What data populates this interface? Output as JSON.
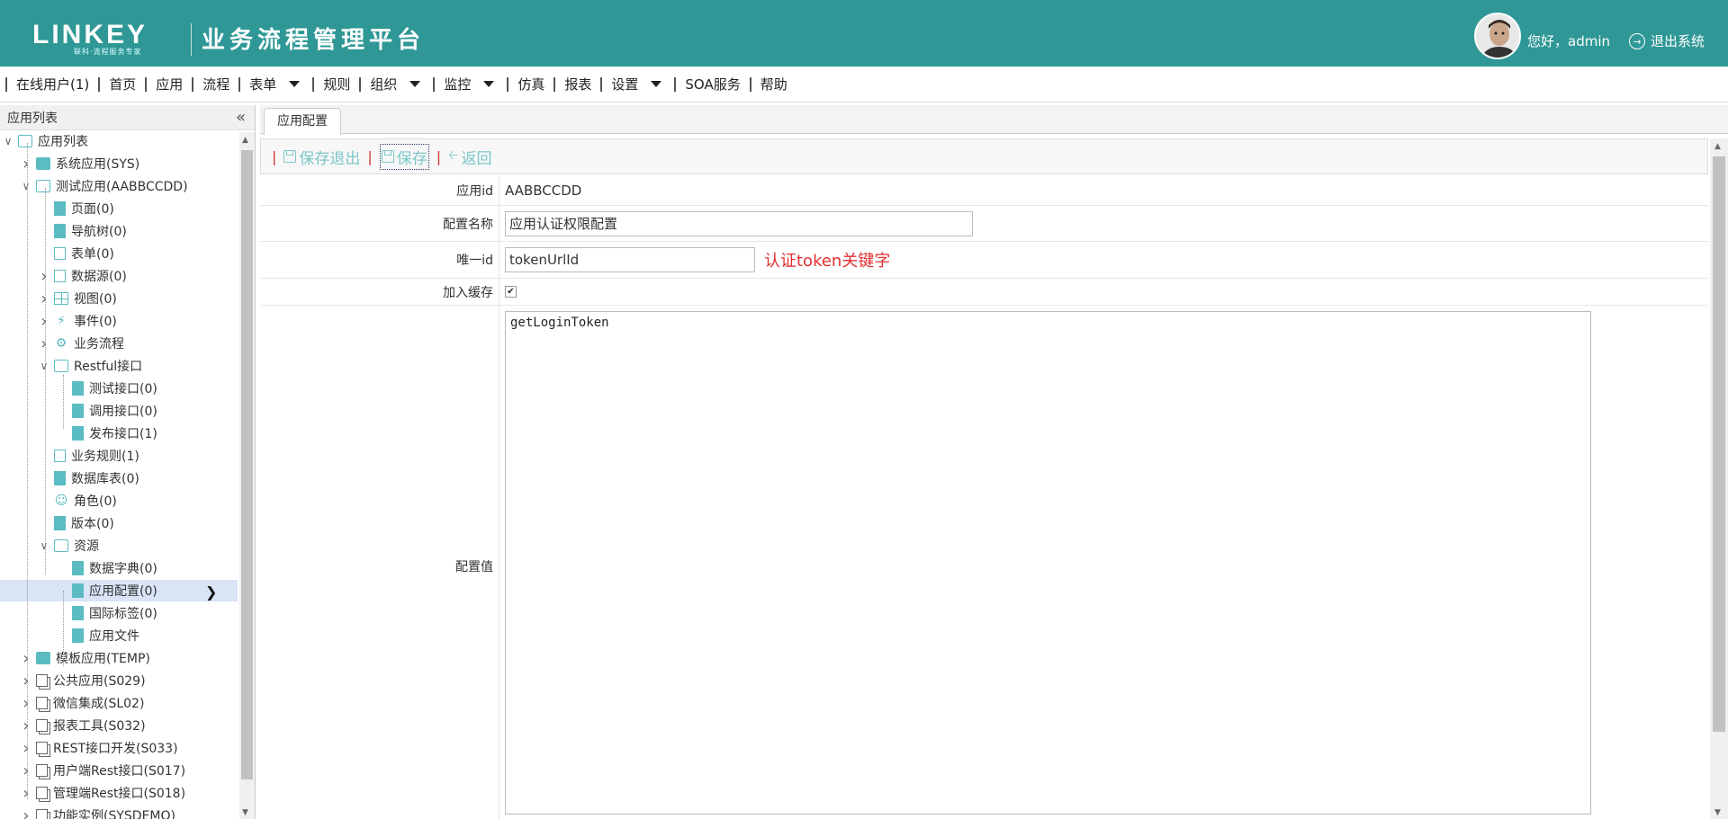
{
  "header": {
    "logo_text": "LINKEY",
    "logo_subtitle": "联科·流程服务专家",
    "app_title": "业务流程管理平台",
    "greeting": "您好，admin",
    "logout_label": "退出系统",
    "background": "#2f9896"
  },
  "menu": {
    "items": [
      {
        "label": "在线用户(1)",
        "has_dropdown": false
      },
      {
        "label": "首页",
        "has_dropdown": false
      },
      {
        "label": "应用",
        "has_dropdown": false
      },
      {
        "label": "流程",
        "has_dropdown": false
      },
      {
        "label": "表单",
        "has_dropdown": true
      },
      {
        "label": "规则",
        "has_dropdown": false
      },
      {
        "label": "组织",
        "has_dropdown": true
      },
      {
        "label": "监控",
        "has_dropdown": true
      },
      {
        "label": "仿真",
        "has_dropdown": false
      },
      {
        "label": "报表",
        "has_dropdown": false
      },
      {
        "label": "设置",
        "has_dropdown": true
      },
      {
        "label": "SOA服务",
        "has_dropdown": false
      },
      {
        "label": "帮助",
        "has_dropdown": false
      }
    ]
  },
  "sidebar": {
    "title": "应用列表",
    "tree": [
      {
        "label": "应用列表",
        "level": 0,
        "toggle": "open",
        "icon": "folder-open-icon"
      },
      {
        "label": "系统应用(SYS)",
        "level": 1,
        "toggle": "closed",
        "icon": "folder-icon"
      },
      {
        "label": "测试应用(AABBCCDD)",
        "level": 1,
        "toggle": "open",
        "icon": "folder-open-icon"
      },
      {
        "label": "页面(0)",
        "level": 2,
        "toggle": "none",
        "icon": "file-icon"
      },
      {
        "label": "导航树(0)",
        "level": 2,
        "toggle": "none",
        "icon": "file-icon"
      },
      {
        "label": "表单(0)",
        "level": 2,
        "toggle": "none",
        "icon": "form-icon"
      },
      {
        "label": "数据源(0)",
        "level": 2,
        "toggle": "closed",
        "icon": "datasource-icon"
      },
      {
        "label": "视图(0)",
        "level": 2,
        "toggle": "closed",
        "icon": "grid-icon"
      },
      {
        "label": "事件(0)",
        "level": 2,
        "toggle": "closed",
        "icon": "bolt-icon"
      },
      {
        "label": "业务流程",
        "level": 2,
        "toggle": "closed",
        "icon": "gears-icon"
      },
      {
        "label": "Restful接口",
        "level": 2,
        "toggle": "open",
        "icon": "folder-open-icon"
      },
      {
        "label": "测试接口(0)",
        "level": 3,
        "toggle": "none",
        "icon": "file-icon"
      },
      {
        "label": "调用接口(0)",
        "level": 3,
        "toggle": "none",
        "icon": "file-icon"
      },
      {
        "label": "发布接口(1)",
        "level": 3,
        "toggle": "none",
        "icon": "file-icon"
      },
      {
        "label": "业务规则(1)",
        "level": 2,
        "toggle": "none",
        "icon": "rules-icon"
      },
      {
        "label": "数据库表(0)",
        "level": 2,
        "toggle": "none",
        "icon": "file-icon"
      },
      {
        "label": "角色(0)",
        "level": 2,
        "toggle": "none",
        "icon": "user-icon"
      },
      {
        "label": "版本(0)",
        "level": 2,
        "toggle": "none",
        "icon": "file-icon"
      },
      {
        "label": "资源",
        "level": 2,
        "toggle": "open",
        "icon": "folder-open-icon"
      },
      {
        "label": "数据字典(0)",
        "level": 3,
        "toggle": "none",
        "icon": "file-icon"
      },
      {
        "label": "应用配置(0)",
        "level": 3,
        "toggle": "none",
        "icon": "file-icon",
        "selected": true
      },
      {
        "label": "国际标签(0)",
        "level": 3,
        "toggle": "none",
        "icon": "file-icon"
      },
      {
        "label": "应用文件",
        "level": 3,
        "toggle": "none",
        "icon": "file-icon"
      },
      {
        "label": "模板应用(TEMP)",
        "level": 1,
        "toggle": "closed",
        "icon": "folder-icon"
      },
      {
        "label": "公共应用(S029)",
        "level": 1,
        "toggle": "closed",
        "icon": "copy-icon"
      },
      {
        "label": "微信集成(SL02)",
        "level": 1,
        "toggle": "closed",
        "icon": "copy-icon"
      },
      {
        "label": "报表工具(S032)",
        "level": 1,
        "toggle": "closed",
        "icon": "copy-icon"
      },
      {
        "label": "REST接口开发(S033)",
        "level": 1,
        "toggle": "closed",
        "icon": "copy-icon"
      },
      {
        "label": "用户端Rest接口(S017)",
        "level": 1,
        "toggle": "closed",
        "icon": "copy-icon"
      },
      {
        "label": "管理端Rest接口(S018)",
        "level": 1,
        "toggle": "closed",
        "icon": "copy-icon"
      },
      {
        "label": "功能实例(SYSDEMO)",
        "level": 1,
        "toggle": "closed",
        "icon": "copy-icon"
      }
    ]
  },
  "content": {
    "tab_label": "应用配置",
    "toolbar": {
      "save_exit_label": "保存退出",
      "save_label": "保存",
      "back_label": "返回"
    },
    "form": {
      "app_id_label": "应用id",
      "app_id_value": "AABBCCDD",
      "config_name_label": "配置名称",
      "config_name_value": "应用认证权限配置",
      "unique_id_label": "唯一id",
      "unique_id_value": "tokenUrlId",
      "unique_id_hint": "认证token关键字",
      "cache_label": "加入缓存",
      "cache_checked": true,
      "config_value_label": "配置值",
      "config_value": "getLoginToken"
    }
  },
  "colors": {
    "header_bg": "#2f9896",
    "accent": "#5bbcc3",
    "toolbar_button": "#7cc7c9",
    "hint_red": "#e03030",
    "selected_bg": "#d9e4f7"
  }
}
